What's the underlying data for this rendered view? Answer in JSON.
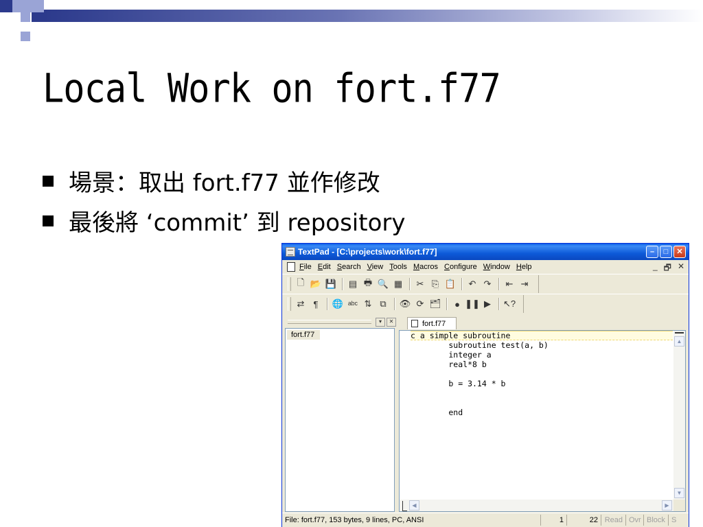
{
  "slide": {
    "title": "Local Work on fort.f77",
    "bullets": [
      "場景：取出 fort.f77 並作修改",
      "最後將 ‘commit’ 到 repository"
    ],
    "colors": {
      "accent": "#2c3a8c",
      "accent_light": "#9aa4d6"
    }
  },
  "window": {
    "title": "TextPad - [C:\\projects\\work\\fort.f77]",
    "controls": {
      "minimize": "–",
      "maximize": "□",
      "close": "✕"
    }
  },
  "menu": {
    "items": [
      {
        "first": "F",
        "rest": "ile"
      },
      {
        "first": "E",
        "rest": "dit"
      },
      {
        "first": "S",
        "rest": "earch"
      },
      {
        "first": "V",
        "rest": "iew"
      },
      {
        "first": "T",
        "rest": "ools"
      },
      {
        "first": "M",
        "rest": "acros"
      },
      {
        "first": "C",
        "rest": "onfigure"
      },
      {
        "first": "W",
        "rest": "indow"
      },
      {
        "first": "H",
        "rest": "elp"
      }
    ],
    "mdi": {
      "minimize": "_",
      "restore": "🗗",
      "close": "✕"
    }
  },
  "toolbar1": {
    "icons": [
      "new-file-icon",
      "open-folder-icon",
      "save-icon",
      "|",
      "manage-files-icon",
      "print-icon",
      "print-preview-icon",
      "document-properties-icon",
      "|",
      "cut-icon",
      "copy-icon",
      "paste-icon",
      "|",
      "undo-icon",
      "redo-icon",
      "|",
      "indent-icon",
      "outdent-icon"
    ],
    "glyphs": [
      "🗋",
      "📂",
      "💾",
      "|",
      "▤",
      "🖶",
      "🔍",
      "▦",
      "|",
      "✂",
      "⎘",
      "📋",
      "|",
      "↶",
      "↷",
      "|",
      "⇤",
      "⇥"
    ]
  },
  "toolbar2": {
    "icons": [
      "word-wrap-icon",
      "pilcrow-icon",
      "|",
      "browser-icon",
      "spelling-icon",
      "sort-icon",
      "compare-icon",
      "|",
      "find-icon",
      "replace-icon",
      "find-in-files-icon",
      "|",
      "record-macro-icon",
      "pause-macro-icon",
      "play-macro-icon",
      "|",
      "context-help-icon"
    ],
    "glyphs": [
      "⇄",
      "¶",
      "|",
      "🌐",
      "ᵃᵇᶜ",
      "⇅",
      "⧉",
      "|",
      "👁",
      "⟳",
      "🗂",
      "|",
      "●",
      "❚❚",
      "▶",
      "|",
      "↖?"
    ]
  },
  "sidepanel": {
    "files": [
      "fort.f77"
    ],
    "buttons": {
      "dock": "▾",
      "close": "✕"
    }
  },
  "editor": {
    "tab_label": "fort.f77",
    "lines": [
      "c a simple subroutine",
      "        subroutine test(a, b)",
      "        integer a",
      "        real*8 b",
      "",
      "        b = 3.14 * b",
      "",
      "",
      "        end"
    ]
  },
  "status": {
    "file_info": "File: fort.f77, 153 bytes, 9 lines, PC, ANSI",
    "line": "1",
    "column": "22",
    "read": "Read",
    "ovr": "Ovr",
    "block": "Block",
    "sync": "S"
  }
}
